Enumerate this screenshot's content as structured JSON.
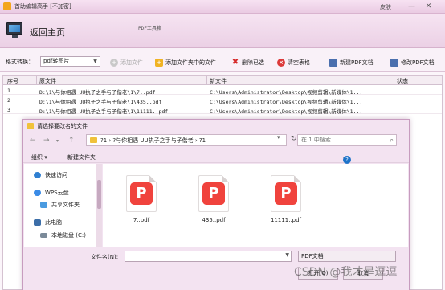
{
  "app": {
    "title": "首助编辑高手 [不加密]",
    "skin_label": "皮肤",
    "min_glyph": "—",
    "close_glyph": "✕"
  },
  "header": {
    "home_label": "返回主页",
    "tool_name": "PDF工具箱"
  },
  "toolbar": {
    "format_label": "格式转换：",
    "format_value": "pdf转图片",
    "add_file": "添加文件",
    "add_folder": "添加文件夹中的文件",
    "delete_selected": "删除已选",
    "clear_table": "清空表格",
    "new_pdf": "新建PDF文档",
    "edit_pdf": "修改PDF文档"
  },
  "table": {
    "columns": [
      "序号",
      "原文件",
      "新文件",
      "状态"
    ],
    "rows": [
      [
        "1",
        "D:\\1\\与你相遇 UU执子之手与子偕老\\1\\7..pdf",
        "C:\\Users\\Administrator\\Desktop\\视频剪辑\\新媒体\\1..."
      ],
      [
        "2",
        "D:\\1\\与你相遇 UU执子之手与子偕老\\1\\435..pdf",
        "C:\\Users\\Administrator\\Desktop\\视频剪辑\\新媒体\\1..."
      ],
      [
        "3",
        "D:\\1\\与你相遇 UU执子之手与子偕老\\1\\11111..pdf",
        "C:\\Users\\Administrator\\Desktop\\视频剪辑\\新媒体\\1..."
      ]
    ]
  },
  "dialog": {
    "title": "请选择要改名的文件",
    "path": "?1  ›  ?与你相遇 UU执子之手与子偕老  ›  ?1",
    "search_placeholder": "在 1 中搜索",
    "organize": "组织 ▾",
    "new_folder": "新建文件夹",
    "nav": [
      {
        "label": "快速访问",
        "icon": "star-icon",
        "color": "#2f7fd1"
      },
      {
        "label": "WPS云盘",
        "icon": "cloud-icon",
        "color": "#3a8be6"
      },
      {
        "label": "共享文件夹",
        "icon": "share-icon",
        "color": "#4a9be0"
      },
      {
        "label": "此电脑",
        "icon": "computer-icon",
        "color": "#3c6ea8"
      },
      {
        "label": "本地磁盘 (C:)",
        "icon": "drive-icon",
        "color": "#7b8a99"
      }
    ],
    "files": [
      "7..pdf",
      "435..pdf",
      "11111..pdf"
    ],
    "filename_label": "文件名(N):",
    "filetype": "PDF文档",
    "open_label": "打开(O)",
    "cancel_label": "取消"
  },
  "watermark": "CSDN @我才是逗逗"
}
